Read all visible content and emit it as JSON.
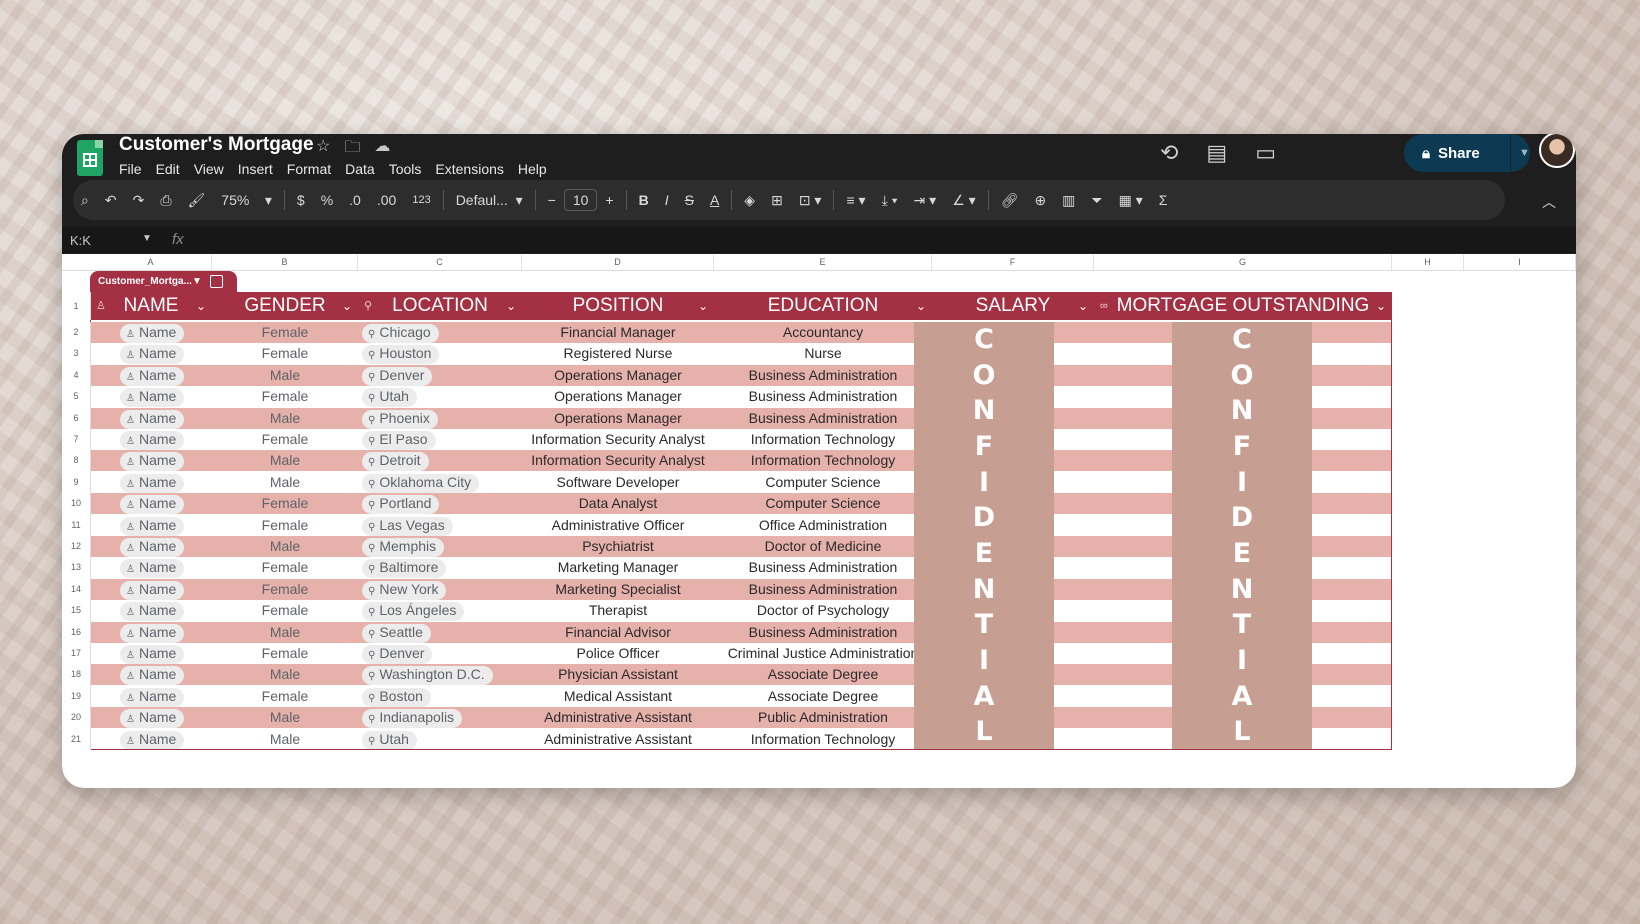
{
  "app": {
    "title": "Customer's Mortgage",
    "menu": [
      "File",
      "Edit",
      "View",
      "Insert",
      "Format",
      "Data",
      "Tools",
      "Extensions",
      "Help"
    ],
    "share_label": "Share"
  },
  "toolbar": {
    "zoom": "75%",
    "currency": "$",
    "percent": "%",
    "dec_down": ".0",
    "dec_up": ".00",
    "number_format": "123",
    "font": "Defaul...",
    "font_size": "10",
    "bold": "B",
    "italic": "I",
    "strike": "S",
    "text_color": "A"
  },
  "formula_bar": {
    "name_box": "K:K",
    "fx": "fx"
  },
  "sheet": {
    "columns": [
      "A",
      "B",
      "C",
      "D",
      "E",
      "F",
      "G",
      "H",
      "I"
    ],
    "table_name": "Customer_Mortga...",
    "headers": [
      "NAME",
      "GENDER",
      "LOCATION",
      "POSITION",
      "EDUCATION",
      "SALARY",
      "MORTGAGE OUTSTANDING"
    ],
    "rows": [
      {
        "n": "2",
        "name": "Name",
        "gender": "Female",
        "location": "Chicago",
        "position": "Financial Manager",
        "education": "Accountancy"
      },
      {
        "n": "3",
        "name": "Name",
        "gender": "Female",
        "location": "Houston",
        "position": "Registered Nurse",
        "education": "Nurse"
      },
      {
        "n": "4",
        "name": "Name",
        "gender": "Male",
        "location": "Denver",
        "position": "Operations Manager",
        "education": "Business Administration"
      },
      {
        "n": "5",
        "name": "Name",
        "gender": "Female",
        "location": "Utah",
        "position": "Operations Manager",
        "education": "Business Administration"
      },
      {
        "n": "6",
        "name": "Name",
        "gender": "Male",
        "location": "Phoenix",
        "position": "Operations Manager",
        "education": "Business Administration"
      },
      {
        "n": "7",
        "name": "Name",
        "gender": "Female",
        "location": "El Paso",
        "position": "Information Security Analyst",
        "education": "Information Technology"
      },
      {
        "n": "8",
        "name": "Name",
        "gender": "Male",
        "location": "Detroit",
        "position": "Information Security Analyst",
        "education": "Information Technology"
      },
      {
        "n": "9",
        "name": "Name",
        "gender": "Male",
        "location": "Oklahoma City",
        "position": "Software Developer",
        "education": "Computer Science"
      },
      {
        "n": "10",
        "name": "Name",
        "gender": "Female",
        "location": "Portland",
        "position": "Data Analyst",
        "education": "Computer Science"
      },
      {
        "n": "11",
        "name": "Name",
        "gender": "Female",
        "location": "Las Vegas",
        "position": "Administrative Officer",
        "education": "Office Administration"
      },
      {
        "n": "12",
        "name": "Name",
        "gender": "Male",
        "location": "Memphis",
        "position": "Psychiatrist",
        "education": "Doctor of Medicine"
      },
      {
        "n": "13",
        "name": "Name",
        "gender": "Female",
        "location": "Baltimore",
        "position": "Marketing Manager",
        "education": "Business Administration"
      },
      {
        "n": "14",
        "name": "Name",
        "gender": "Female",
        "location": "New York",
        "position": "Marketing Specialist",
        "education": "Business Administration"
      },
      {
        "n": "15",
        "name": "Name",
        "gender": "Female",
        "location": "Los Ángeles",
        "position": "Therapist",
        "education": "Doctor of Psychology"
      },
      {
        "n": "16",
        "name": "Name",
        "gender": "Male",
        "location": "Seattle",
        "position": "Financial Advisor",
        "education": "Business Administration"
      },
      {
        "n": "17",
        "name": "Name",
        "gender": "Female",
        "location": "Denver",
        "position": "Police Officer",
        "education": "Criminal Justice Administration"
      },
      {
        "n": "18",
        "name": "Name",
        "gender": "Male",
        "location": "Washington D.C.",
        "position": "Physician Assistant",
        "education": "Associate Degree"
      },
      {
        "n": "19",
        "name": "Name",
        "gender": "Female",
        "location": "Boston",
        "position": "Medical Assistant",
        "education": "Associate Degree"
      },
      {
        "n": "20",
        "name": "Name",
        "gender": "Male",
        "location": "Indianapolis",
        "position": "Administrative Assistant",
        "education": "Public Administration"
      },
      {
        "n": "21",
        "name": "Name",
        "gender": "Male",
        "location": "Utah",
        "position": "Administrative Assistant",
        "education": "Information Technology"
      }
    ],
    "confidential_letters": [
      "C",
      "O",
      "N",
      "F",
      "I",
      "D",
      "E",
      "N",
      "T",
      "I",
      "A",
      "L"
    ]
  },
  "colors": {
    "header_bg": "#a33143",
    "band_row": "#e6b1ab",
    "confidential_block": "#c69e92",
    "share_bg": "#0b3a52"
  }
}
